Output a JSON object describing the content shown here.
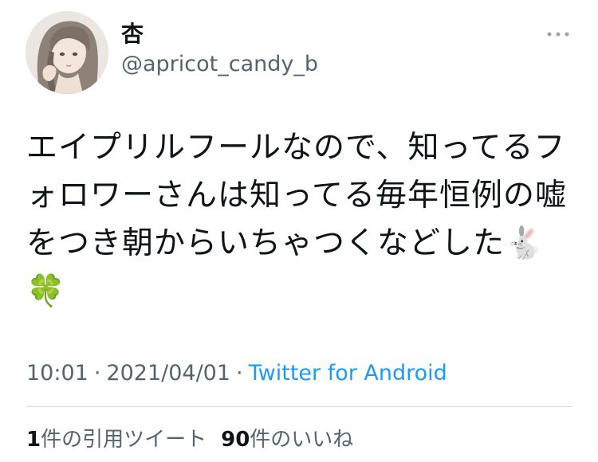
{
  "author": {
    "display_name": "杏",
    "handle": "@apricot_candy_b"
  },
  "tweet": {
    "text": "エイプリルフールなので、知ってるフォロワーさんは知ってる毎年恒例の嘘をつき朝からいちゃつくなどした🐇🍀"
  },
  "meta": {
    "time": "10:01",
    "separator": "·",
    "date": "2021/04/01",
    "source": "Twitter for Android"
  },
  "stats": {
    "quote_count": "1",
    "quote_label": "件の引用ツイート",
    "like_count": "90",
    "like_label": "件のいいね"
  },
  "icons": {
    "more": "more-horizontal-icon"
  },
  "colors": {
    "text": "#0f1419",
    "secondary": "#536471",
    "link": "#1d9bf0"
  }
}
